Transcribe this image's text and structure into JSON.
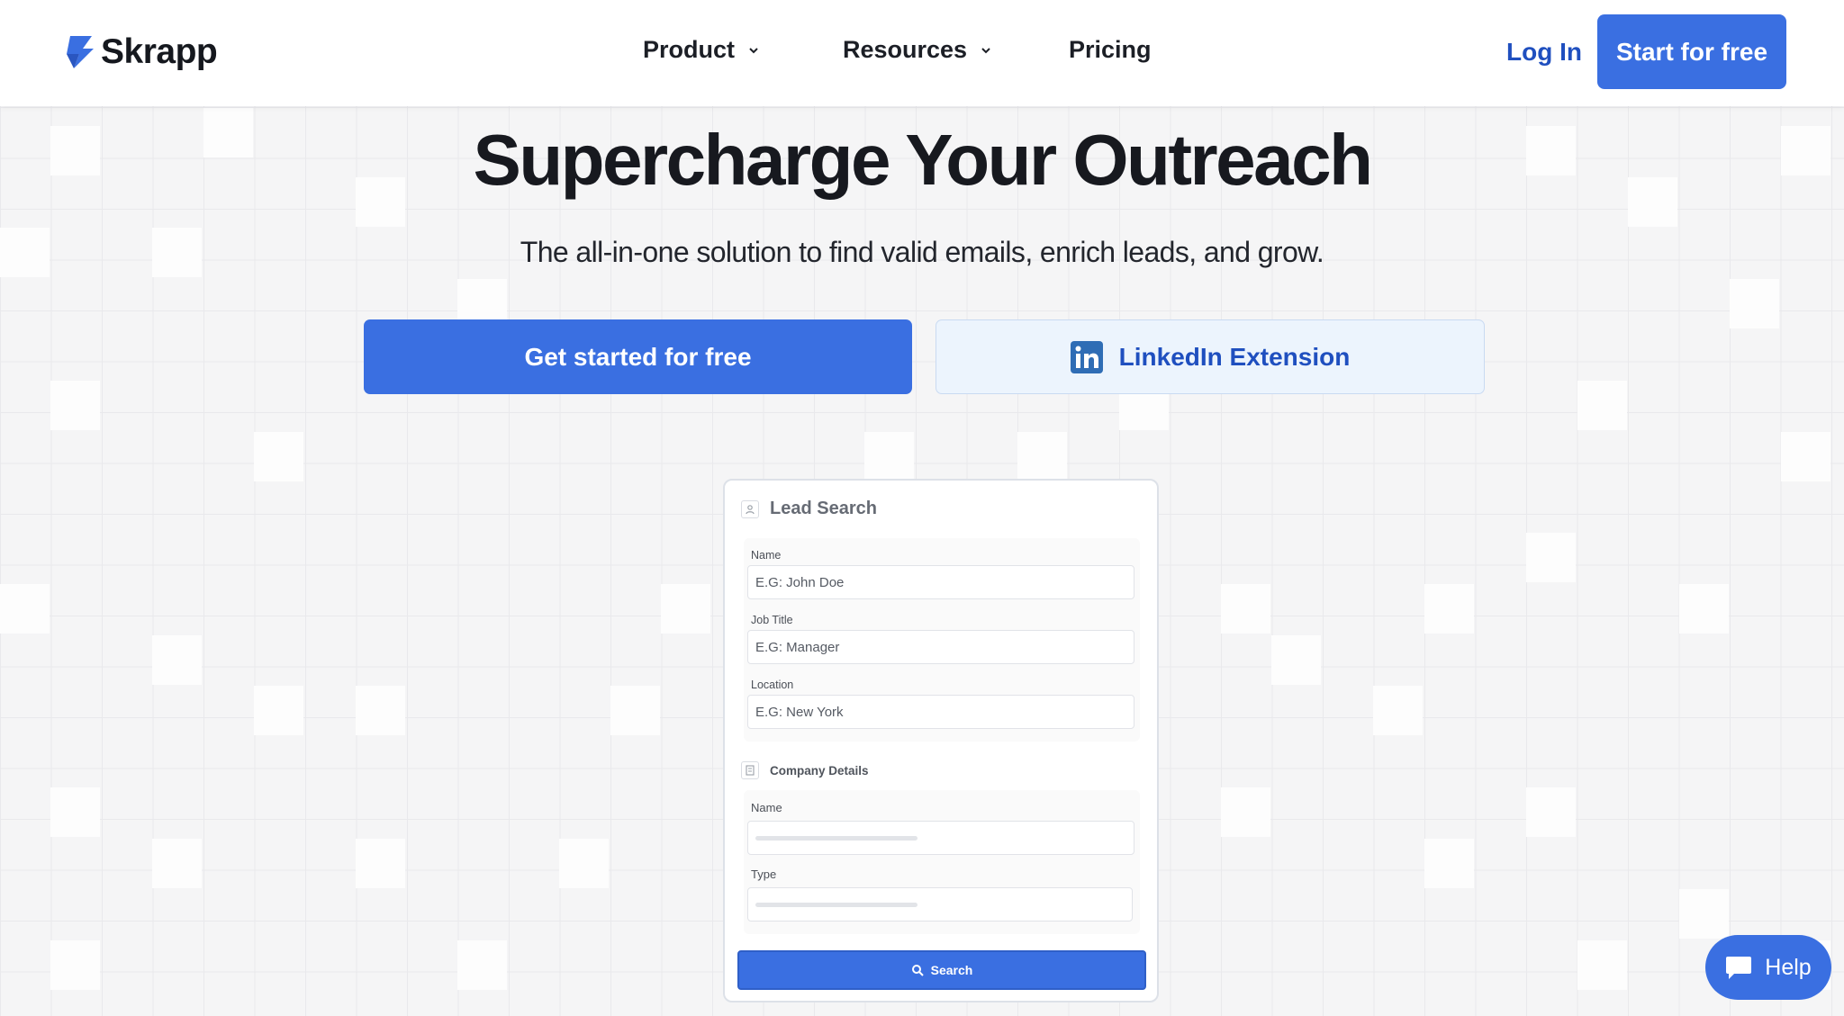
{
  "brand": {
    "name": "Skrapp",
    "color": "#3a6fe1"
  },
  "nav": {
    "items": [
      {
        "label": "Product",
        "has_dropdown": true
      },
      {
        "label": "Resources",
        "has_dropdown": true
      },
      {
        "label": "Pricing",
        "has_dropdown": false
      }
    ],
    "login_label": "Log In",
    "start_label": "Start for free"
  },
  "hero": {
    "title": "Supercharge Your Outreach",
    "subtitle": "The all-in-one solution to find valid emails, enrich leads, and grow.",
    "cta_primary": "Get started for free",
    "cta_secondary": "LinkedIn Extension"
  },
  "lead_card": {
    "title": "Lead Search",
    "fields": [
      {
        "label": "Name",
        "placeholder": "E.G: John Doe"
      },
      {
        "label": "Job Title",
        "placeholder": "E.G: Manager"
      },
      {
        "label": "Location",
        "placeholder": "E.G: New York"
      }
    ],
    "company_title": "Company Details",
    "company_fields": [
      {
        "label": "Name"
      },
      {
        "label": "Type"
      }
    ],
    "search_label": "Search"
  },
  "help": {
    "label": "Help"
  },
  "icons": {
    "logo": "skrapp-logo-icon",
    "chevron": "chevron-down-icon",
    "linkedin": "linkedin-icon",
    "user": "user-icon",
    "building": "building-icon",
    "search": "search-icon",
    "chat": "chat-bubble-icon"
  }
}
